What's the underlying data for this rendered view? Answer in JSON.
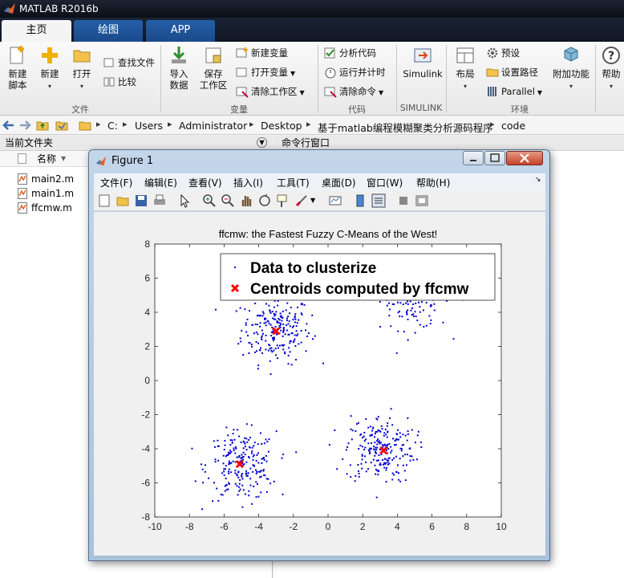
{
  "app": {
    "title": "MATLAB R2016b"
  },
  "tabs": [
    "主页",
    "绘图",
    "APP"
  ],
  "ribbon": {
    "big_buttons": [
      {
        "id": "new-script",
        "label1": "新建",
        "label2": "脚本"
      },
      {
        "id": "new",
        "label1": "新建",
        "label2": "▾"
      },
      {
        "id": "open",
        "label1": "打开",
        "label2": "▾"
      },
      {
        "id": "import",
        "label1": "导入",
        "label2": "数据"
      },
      {
        "id": "save-workspace",
        "label1": "保存",
        "label2": "工作区"
      },
      {
        "id": "simulink",
        "label1": "Simulink",
        "label2": ""
      },
      {
        "id": "layout",
        "label1": "布局",
        "label2": "▾"
      },
      {
        "id": "addons",
        "label1": "附加功能",
        "label2": "▾"
      },
      {
        "id": "help",
        "label1": "帮助",
        "label2": "▾"
      }
    ],
    "small_buttons": {
      "find_files": "查找文件",
      "compare": "比较",
      "new_variable": "新建变量",
      "open_variable": "打开变量",
      "clear_workspace": "清除工作区",
      "analyze_code": "分析代码",
      "run_and_time": "运行并计时",
      "clear_commands": "清除命令",
      "preferences": "预设",
      "set_path": "设置路径",
      "parallel": "Parallel"
    },
    "groups": {
      "file": "文件",
      "variable": "变量",
      "code": "代码",
      "simulink": "SIMULINK",
      "environment": "环境"
    }
  },
  "address": {
    "crumbs": [
      "C:",
      "Users",
      "Administrator",
      "Desktop",
      "基于matlab编程模糊聚类分析源码程序",
      "code"
    ]
  },
  "current_folder": {
    "title": "当前文件夹",
    "column_name": "名称",
    "files": [
      "main2.m",
      "main1.m",
      "ffcmw.m"
    ]
  },
  "command_window": {
    "title": "命令行窗口"
  },
  "figure": {
    "title": "Figure 1",
    "menu": [
      "文件(F)",
      "编辑(E)",
      "查看(V)",
      "插入(I)",
      "工具(T)",
      "桌面(D)",
      "窗口(W)",
      "帮助(H)"
    ]
  },
  "colors": {
    "data": "#0000cc",
    "centroid": "#ff0000",
    "ribbon_tab": "#1f5797"
  },
  "chart_data": {
    "type": "scatter",
    "title": "ffcmw: the Fastest Fuzzy C-Means of the West!",
    "xlim": [
      -10,
      10
    ],
    "ylim": [
      -8,
      8
    ],
    "xticks": [
      -10,
      -8,
      -6,
      -4,
      -2,
      0,
      2,
      4,
      6,
      8,
      10
    ],
    "yticks": [
      -8,
      -6,
      -4,
      -2,
      0,
      2,
      4,
      6,
      8
    ],
    "legend_position": "top",
    "series": [
      {
        "name": "Data to clusterize",
        "marker": "dot",
        "clusters": [
          {
            "center": [
              -3,
              3
            ],
            "spread": 1.0,
            "count": 220
          },
          {
            "center": [
              5,
              5
            ],
            "spread": 1.0,
            "count": 160
          },
          {
            "center": [
              -5,
              -5
            ],
            "spread": 1.0,
            "count": 220
          },
          {
            "center": [
              3,
              -4
            ],
            "spread": 1.0,
            "count": 220
          }
        ]
      },
      {
        "name": "Centroids computed by ffcmw",
        "marker": "x",
        "points": [
          [
            -3.0,
            2.9
          ],
          [
            -5.1,
            -4.9
          ],
          [
            3.2,
            -4.1
          ],
          [
            4.9,
            4.9
          ]
        ]
      }
    ]
  }
}
